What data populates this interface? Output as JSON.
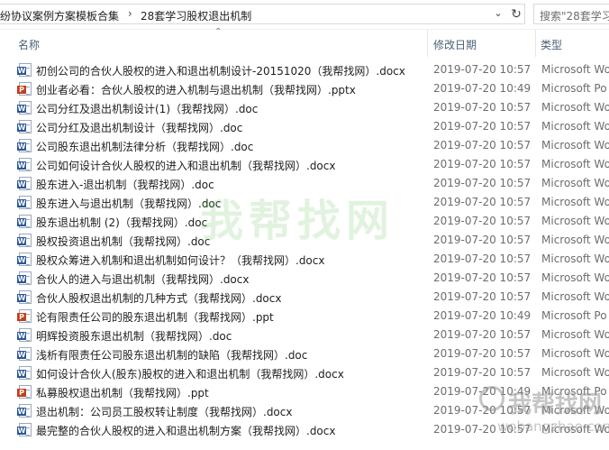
{
  "breadcrumb": {
    "items": [
      "纷协议案例方案模板合集",
      "28套学习股权退出机制"
    ],
    "separator": "›"
  },
  "search": {
    "placeholder": "搜索\"28套学习"
  },
  "columns": {
    "name": "名称",
    "date": "修改日期",
    "type": "类型"
  },
  "files": [
    {
      "name": "初创公司的合伙人股权的进入和退出机制设计-20151020（我帮找网）.docx",
      "date": "2019-07-20 10:57",
      "type": "Microsoft Wo",
      "icon": "word-doc-icon"
    },
    {
      "name": "创业者必看：合伙人股权的进入机制与退出机制（我帮找网）.pptx",
      "date": "2019-07-20 10:49",
      "type": "Microsoft Po",
      "icon": "ppt-doc-icon"
    },
    {
      "name": "公司分红及退出机制设计(1)（我帮找网）.doc",
      "date": "2019-07-20 10:57",
      "type": "Microsoft Wo",
      "icon": "word-doc-icon"
    },
    {
      "name": "公司分红及退出机制设计（我帮找网）.doc",
      "date": "2019-07-20 10:57",
      "type": "Microsoft Wo",
      "icon": "word-doc-icon"
    },
    {
      "name": "公司股东退出机制法律分析（我帮找网）.doc",
      "date": "2019-07-20 10:57",
      "type": "Microsoft Wo",
      "icon": "word-doc-icon"
    },
    {
      "name": "公司如何设计合伙人股权的进入和退出机制（我帮找网）.docx",
      "date": "2019-07-20 10:57",
      "type": "Microsoft Wo",
      "icon": "word-doc-icon"
    },
    {
      "name": "股东进入-退出机制（我帮找网）.doc",
      "date": "2019-07-20 10:57",
      "type": "Microsoft Wo",
      "icon": "word-doc-icon"
    },
    {
      "name": "股东进入与退出机制（我帮找网）.doc",
      "date": "2019-07-20 10:57",
      "type": "Microsoft Wo",
      "icon": "word-doc-icon"
    },
    {
      "name": "股东退出机制 (2)（我帮找网）.doc",
      "date": "2019-07-20 10:57",
      "type": "Microsoft Wo",
      "icon": "word-doc-icon"
    },
    {
      "name": "股权投资退出机制（我帮找网）.doc",
      "date": "2019-07-20 10:57",
      "type": "Microsoft Wo",
      "icon": "word-doc-icon"
    },
    {
      "name": "股权众筹进入机制和退出机制如何设计？（我帮找网）.docx",
      "date": "2019-07-20 10:57",
      "type": "Microsoft Wo",
      "icon": "word-doc-icon"
    },
    {
      "name": "合伙人的进入与退出机制（我帮找网）.docx",
      "date": "2019-07-20 10:57",
      "type": "Microsoft Wo",
      "icon": "word-doc-icon"
    },
    {
      "name": "合伙人股权退出机制的几种方式（我帮找网）.docx",
      "date": "2019-07-20 10:57",
      "type": "Microsoft Wo",
      "icon": "word-doc-icon"
    },
    {
      "name": "论有限责任公司的股东退出机制（我帮找网）.ppt",
      "date": "2019-07-20 10:49",
      "type": "Microsoft Po",
      "icon": "ppt-doc-icon"
    },
    {
      "name": "明辉投资股东退出机制（我帮找网）.doc",
      "date": "2019-07-20 10:57",
      "type": "Microsoft Wo",
      "icon": "word-doc-icon"
    },
    {
      "name": "浅析有限责任公司股东退出机制的缺陷（我帮找网）.doc",
      "date": "2019-07-20 10:57",
      "type": "Microsoft Wo",
      "icon": "word-doc-icon"
    },
    {
      "name": "如何设计合伙人(股东)股权的进入和退出机制（我帮找网）.docx",
      "date": "2019-07-20 10:57",
      "type": "Microsoft Wo",
      "icon": "word-doc-icon"
    },
    {
      "name": "私募股权退出机制（我帮找网）.ppt",
      "date": "2019-07-20 10:49",
      "type": "Microsoft Po",
      "icon": "ppt-doc-icon"
    },
    {
      "name": "退出机制：公司员工股权转让制度（我帮找网）.docx",
      "date": "2019-07-20 10:57",
      "type": "Microsoft Wo",
      "icon": "word-doc-icon"
    },
    {
      "name": "最完整的合伙人股权的进入和退出机制方案（我帮找网）.docx",
      "date": "2019-07-20 10:57",
      "type": "Microsoft Wo",
      "icon": "word-doc-icon"
    }
  ],
  "watermark": {
    "center": "我帮找网",
    "corner": "我帮找网",
    "corner_url": "wobangzhao.com"
  }
}
